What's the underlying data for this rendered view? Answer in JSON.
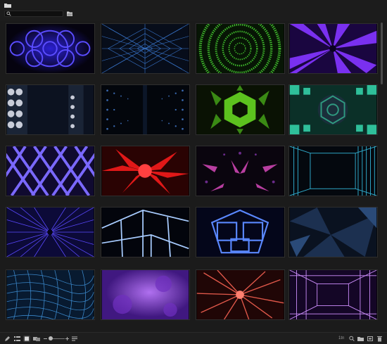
{
  "top": {
    "folder_icon": "folder-icon",
    "search": {
      "icon": "search-icon",
      "value": "",
      "placeholder": ""
    },
    "browse_icon": "folder-open-icon"
  },
  "thumbnails": [
    {
      "name": "thumb-1",
      "theme": "blue-kaleidoscope",
      "colors": [
        "#3a2dff",
        "#120a5a"
      ]
    },
    {
      "name": "thumb-2",
      "theme": "blue-grid-tunnel",
      "colors": [
        "#3b7bd8",
        "#0b1930"
      ]
    },
    {
      "name": "thumb-3",
      "theme": "green-dot-rings",
      "colors": [
        "#39b82c",
        "#0a2408"
      ]
    },
    {
      "name": "thumb-4",
      "theme": "purple-spiral",
      "colors": [
        "#8a3cff",
        "#2a0a66"
      ]
    },
    {
      "name": "thumb-5",
      "theme": "white-spheres",
      "colors": [
        "#d6d6e0",
        "#121a2a"
      ]
    },
    {
      "name": "thumb-6",
      "theme": "blue-dot-corridor",
      "colors": [
        "#3a69b0",
        "#05080f"
      ]
    },
    {
      "name": "thumb-7",
      "theme": "green-hexagon",
      "colors": [
        "#6ad024",
        "#0f2a05"
      ]
    },
    {
      "name": "thumb-8",
      "theme": "teal-kaleidoscope",
      "colors": [
        "#2fbf9a",
        "#0a2e28"
      ]
    },
    {
      "name": "thumb-9",
      "theme": "violet-lattice",
      "colors": [
        "#7a68ff",
        "#150d40"
      ]
    },
    {
      "name": "thumb-10",
      "theme": "red-crystal-burst",
      "colors": [
        "#ff2020",
        "#3a0404"
      ]
    },
    {
      "name": "thumb-11",
      "theme": "pink-bead-pattern",
      "colors": [
        "#c44ab0",
        "#0c0612"
      ]
    },
    {
      "name": "thumb-12",
      "theme": "cyan-box-room",
      "colors": [
        "#2fb0d0",
        "#050c14"
      ]
    },
    {
      "name": "thumb-13",
      "theme": "blue-ray-tunnel",
      "colors": [
        "#5a49ff",
        "#0c0a3a"
      ]
    },
    {
      "name": "thumb-14",
      "theme": "white-neon-cube",
      "colors": [
        "#9ec8ff",
        "#04060e"
      ]
    },
    {
      "name": "thumb-15",
      "theme": "blue-neon-pentagon",
      "colors": [
        "#4a78ff",
        "#04061a"
      ]
    },
    {
      "name": "thumb-16",
      "theme": "dark-blue-shards",
      "colors": [
        "#2a4a78",
        "#0a1220"
      ]
    },
    {
      "name": "thumb-17",
      "theme": "blue-wave-mesh",
      "colors": [
        "#3a86c8",
        "#081a30"
      ]
    },
    {
      "name": "thumb-18",
      "theme": "violet-nebula",
      "colors": [
        "#a060e0",
        "#4a1c8a"
      ]
    },
    {
      "name": "thumb-19",
      "theme": "red-fiber-burst",
      "colors": [
        "#e0584a",
        "#2a0808"
      ]
    },
    {
      "name": "thumb-20",
      "theme": "violet-neon-room",
      "colors": [
        "#d68aff",
        "#140626"
      ]
    }
  ],
  "bottom": {
    "icons": [
      "edit-icon",
      "list-view-icon",
      "grid-view-icon",
      "filmstrip-view-icon",
      "zoom-out-icon",
      "zoom-in-icon",
      "menu-icon",
      "search-icon",
      "new-folder-icon",
      "settings-icon",
      "trash-icon"
    ],
    "count_label": "1tn"
  }
}
